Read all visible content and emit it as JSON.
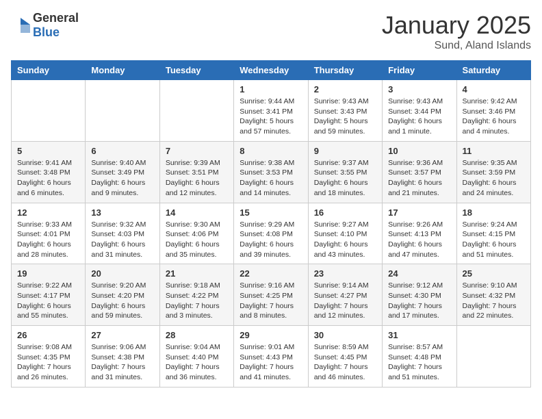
{
  "header": {
    "logo_general": "General",
    "logo_blue": "Blue",
    "month_title": "January 2025",
    "location": "Sund, Aland Islands"
  },
  "days_of_week": [
    "Sunday",
    "Monday",
    "Tuesday",
    "Wednesday",
    "Thursday",
    "Friday",
    "Saturday"
  ],
  "weeks": [
    [
      {
        "day": "",
        "info": ""
      },
      {
        "day": "",
        "info": ""
      },
      {
        "day": "",
        "info": ""
      },
      {
        "day": "1",
        "info": "Sunrise: 9:44 AM\nSunset: 3:41 PM\nDaylight: 5 hours and 57 minutes."
      },
      {
        "day": "2",
        "info": "Sunrise: 9:43 AM\nSunset: 3:43 PM\nDaylight: 5 hours and 59 minutes."
      },
      {
        "day": "3",
        "info": "Sunrise: 9:43 AM\nSunset: 3:44 PM\nDaylight: 6 hours and 1 minute."
      },
      {
        "day": "4",
        "info": "Sunrise: 9:42 AM\nSunset: 3:46 PM\nDaylight: 6 hours and 4 minutes."
      }
    ],
    [
      {
        "day": "5",
        "info": "Sunrise: 9:41 AM\nSunset: 3:48 PM\nDaylight: 6 hours and 6 minutes."
      },
      {
        "day": "6",
        "info": "Sunrise: 9:40 AM\nSunset: 3:49 PM\nDaylight: 6 hours and 9 minutes."
      },
      {
        "day": "7",
        "info": "Sunrise: 9:39 AM\nSunset: 3:51 PM\nDaylight: 6 hours and 12 minutes."
      },
      {
        "day": "8",
        "info": "Sunrise: 9:38 AM\nSunset: 3:53 PM\nDaylight: 6 hours and 14 minutes."
      },
      {
        "day": "9",
        "info": "Sunrise: 9:37 AM\nSunset: 3:55 PM\nDaylight: 6 hours and 18 minutes."
      },
      {
        "day": "10",
        "info": "Sunrise: 9:36 AM\nSunset: 3:57 PM\nDaylight: 6 hours and 21 minutes."
      },
      {
        "day": "11",
        "info": "Sunrise: 9:35 AM\nSunset: 3:59 PM\nDaylight: 6 hours and 24 minutes."
      }
    ],
    [
      {
        "day": "12",
        "info": "Sunrise: 9:33 AM\nSunset: 4:01 PM\nDaylight: 6 hours and 28 minutes."
      },
      {
        "day": "13",
        "info": "Sunrise: 9:32 AM\nSunset: 4:03 PM\nDaylight: 6 hours and 31 minutes."
      },
      {
        "day": "14",
        "info": "Sunrise: 9:30 AM\nSunset: 4:06 PM\nDaylight: 6 hours and 35 minutes."
      },
      {
        "day": "15",
        "info": "Sunrise: 9:29 AM\nSunset: 4:08 PM\nDaylight: 6 hours and 39 minutes."
      },
      {
        "day": "16",
        "info": "Sunrise: 9:27 AM\nSunset: 4:10 PM\nDaylight: 6 hours and 43 minutes."
      },
      {
        "day": "17",
        "info": "Sunrise: 9:26 AM\nSunset: 4:13 PM\nDaylight: 6 hours and 47 minutes."
      },
      {
        "day": "18",
        "info": "Sunrise: 9:24 AM\nSunset: 4:15 PM\nDaylight: 6 hours and 51 minutes."
      }
    ],
    [
      {
        "day": "19",
        "info": "Sunrise: 9:22 AM\nSunset: 4:17 PM\nDaylight: 6 hours and 55 minutes."
      },
      {
        "day": "20",
        "info": "Sunrise: 9:20 AM\nSunset: 4:20 PM\nDaylight: 6 hours and 59 minutes."
      },
      {
        "day": "21",
        "info": "Sunrise: 9:18 AM\nSunset: 4:22 PM\nDaylight: 7 hours and 3 minutes."
      },
      {
        "day": "22",
        "info": "Sunrise: 9:16 AM\nSunset: 4:25 PM\nDaylight: 7 hours and 8 minutes."
      },
      {
        "day": "23",
        "info": "Sunrise: 9:14 AM\nSunset: 4:27 PM\nDaylight: 7 hours and 12 minutes."
      },
      {
        "day": "24",
        "info": "Sunrise: 9:12 AM\nSunset: 4:30 PM\nDaylight: 7 hours and 17 minutes."
      },
      {
        "day": "25",
        "info": "Sunrise: 9:10 AM\nSunset: 4:32 PM\nDaylight: 7 hours and 22 minutes."
      }
    ],
    [
      {
        "day": "26",
        "info": "Sunrise: 9:08 AM\nSunset: 4:35 PM\nDaylight: 7 hours and 26 minutes."
      },
      {
        "day": "27",
        "info": "Sunrise: 9:06 AM\nSunset: 4:38 PM\nDaylight: 7 hours and 31 minutes."
      },
      {
        "day": "28",
        "info": "Sunrise: 9:04 AM\nSunset: 4:40 PM\nDaylight: 7 hours and 36 minutes."
      },
      {
        "day": "29",
        "info": "Sunrise: 9:01 AM\nSunset: 4:43 PM\nDaylight: 7 hours and 41 minutes."
      },
      {
        "day": "30",
        "info": "Sunrise: 8:59 AM\nSunset: 4:45 PM\nDaylight: 7 hours and 46 minutes."
      },
      {
        "day": "31",
        "info": "Sunrise: 8:57 AM\nSunset: 4:48 PM\nDaylight: 7 hours and 51 minutes."
      },
      {
        "day": "",
        "info": ""
      }
    ]
  ]
}
